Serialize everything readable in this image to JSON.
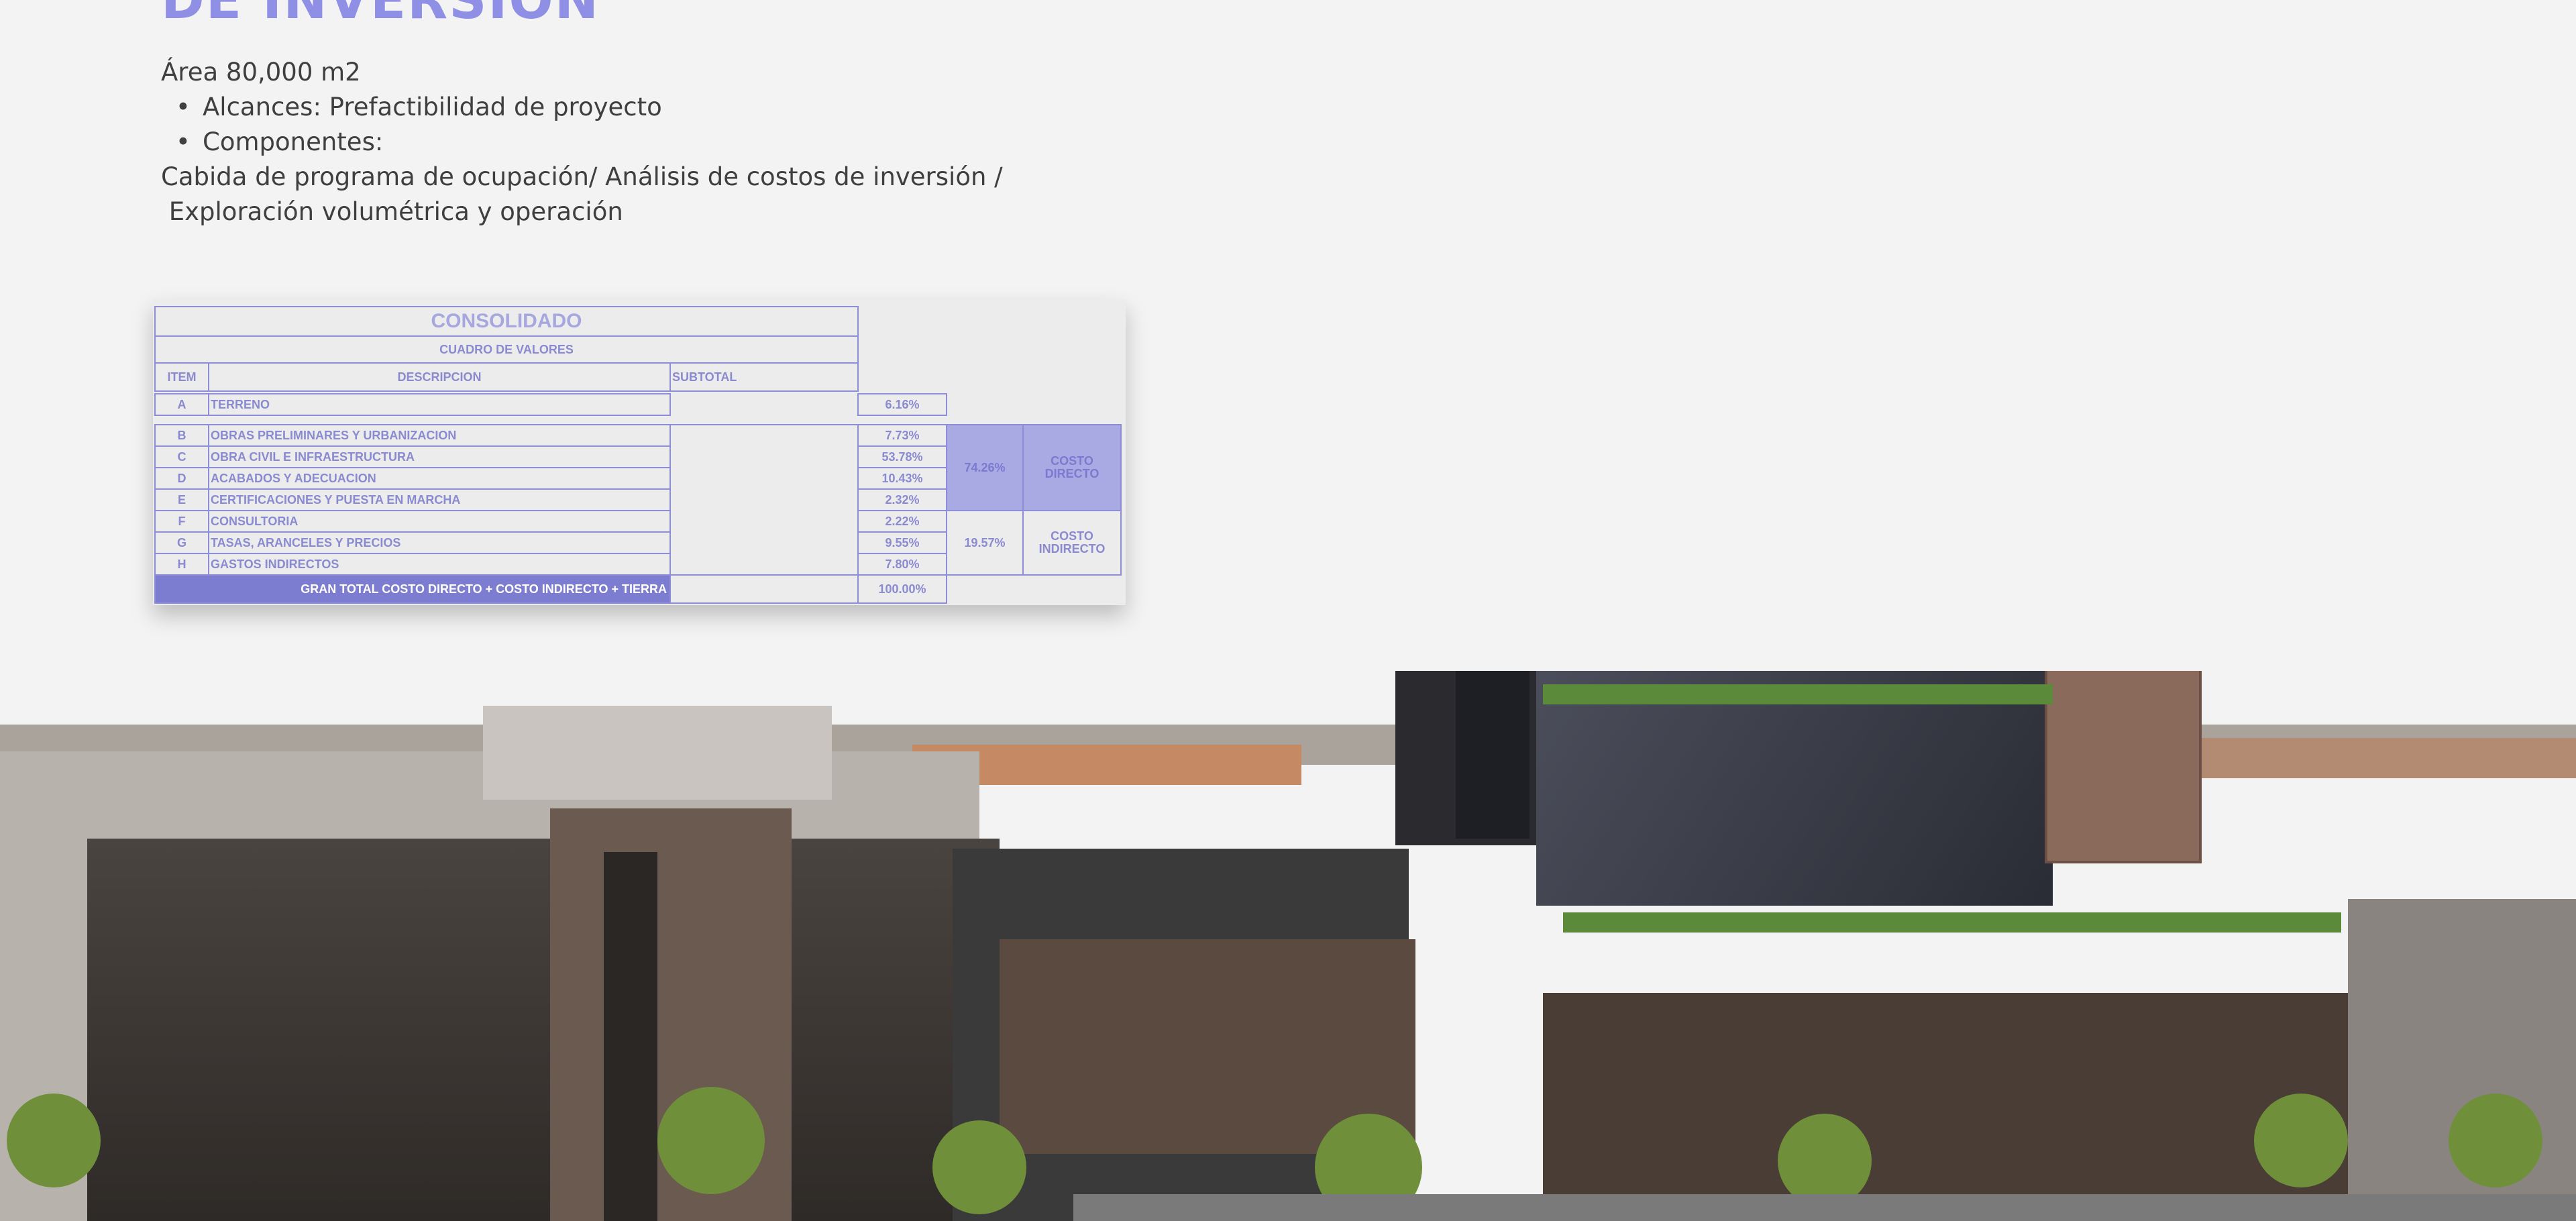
{
  "heading": "DE INVERSIÓN",
  "info": {
    "area": "Área 80,000 m2",
    "bullets": [
      "Alcances: Prefactibilidad de proyecto",
      "Componentes:"
    ],
    "components_line1": "Cabida de programa de ocupación/ Análisis de costos de inversión /",
    "components_line2": " Exploración volumétrica y operación"
  },
  "table": {
    "title": "CONSOLIDADO",
    "subtitle": "CUADRO DE VALORES",
    "headers": {
      "item": "ITEM",
      "description": "DESCRIPCION",
      "subtotal": "SUBTOTAL"
    },
    "rows": [
      {
        "item": "A",
        "description": "TERRENO",
        "percent": "6.16%"
      },
      {
        "item": "B",
        "description": "OBRAS PRELIMINARES Y URBANIZACION",
        "percent": "7.73%"
      },
      {
        "item": "C",
        "description": "OBRA CIVIL E INFRAESTRUCTURA",
        "percent": "53.78%"
      },
      {
        "item": "D",
        "description": "ACABADOS Y ADECUACION",
        "percent": "10.43%"
      },
      {
        "item": "E",
        "description": "CERTIFICACIONES Y PUESTA EN MARCHA",
        "percent": "2.32%"
      },
      {
        "item": "F",
        "description": "CONSULTORIA",
        "percent": "2.22%"
      },
      {
        "item": "G",
        "description": "TASAS, ARANCELES Y PRECIOS",
        "percent": "9.55%"
      },
      {
        "item": "H",
        "description": "GASTOS INDIRECTOS",
        "percent": "7.80%"
      }
    ],
    "direct": {
      "percent": "74.26%",
      "label": "COSTO DIRECTO"
    },
    "indirect": {
      "percent": "19.57%",
      "label": "COSTO INDIRECTO"
    },
    "total": {
      "label": "GRAN TOTAL COSTO DIRECTO + COSTO INDIRECTO + TIERRA",
      "percent": "100.00%"
    }
  },
  "colors": {
    "accent": "#8f8fe6",
    "table_line": "#8e8ed8",
    "table_dark": "#7c7cd0",
    "table_fill": "#a9a9e4"
  }
}
